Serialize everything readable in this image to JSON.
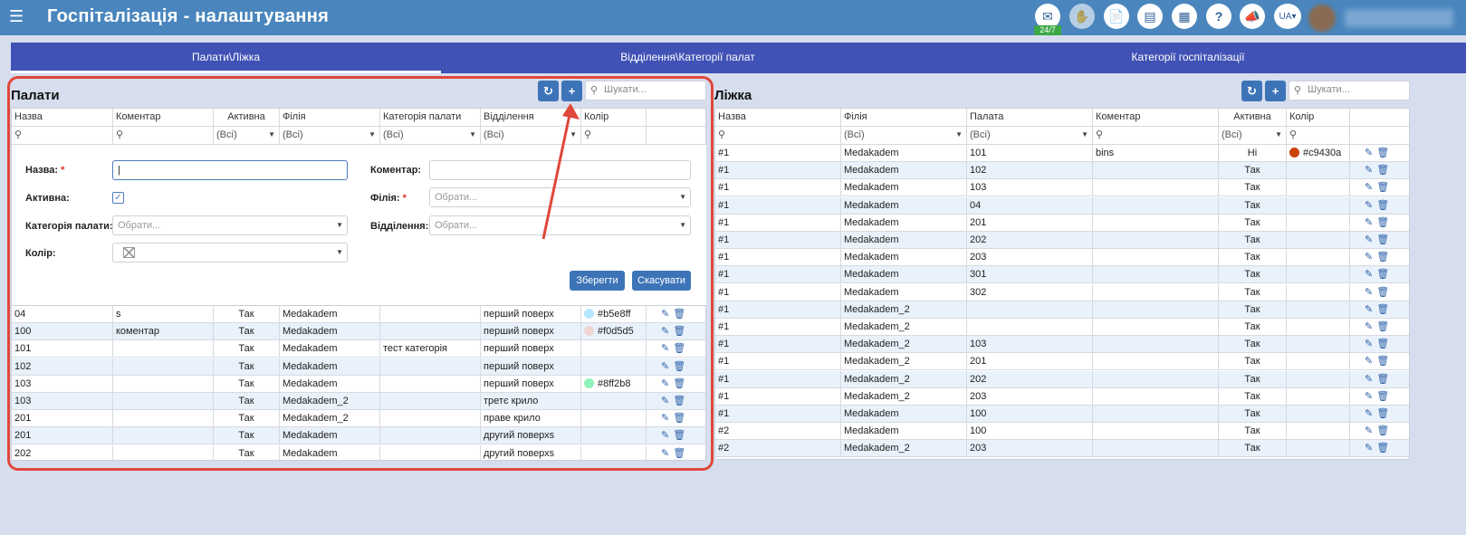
{
  "header": {
    "title": "Госпіталізація - налаштування",
    "menu_icon": "hamburger-icon",
    "chat_badge": "24/7",
    "lang": "UA"
  },
  "tabs": [
    {
      "label": "Палати\\Ліжка"
    },
    {
      "label": "Відділення\\Категорії палат"
    },
    {
      "label": "Категорії госпіталізації"
    }
  ],
  "wards": {
    "title": "Палати",
    "search_placeholder": "Шукати...",
    "columns": [
      "Назва",
      "Коментар",
      "Активна",
      "Філія",
      "Категорія палати",
      "Відділення",
      "Колір"
    ],
    "filter_all": "(Всі)",
    "form": {
      "name_label": "Назва:",
      "comment_label": "Коментар:",
      "active_label": "Активна:",
      "branch_label": "Філія:",
      "category_label": "Категорія палати:",
      "department_label": "Відділення:",
      "color_label": "Колір:",
      "select_placeholder": "Обрати...",
      "save_label": "Зберегти",
      "cancel_label": "Скасувати"
    },
    "rows": [
      {
        "name": "04",
        "comment": "s",
        "active": "Так",
        "branch": "Medakadem",
        "category": "",
        "department": "перший поверх",
        "color": "#b5e8ff"
      },
      {
        "name": "100",
        "comment": "коментар",
        "active": "Так",
        "branch": "Medakadem",
        "category": "",
        "department": "перший поверх",
        "color": "#f0d5d5"
      },
      {
        "name": "101",
        "comment": "",
        "active": "Так",
        "branch": "Medakadem",
        "category": "тест категорія",
        "department": "перший поверх",
        "color": ""
      },
      {
        "name": "102",
        "comment": "",
        "active": "Так",
        "branch": "Medakadem",
        "category": "",
        "department": "перший поверх",
        "color": ""
      },
      {
        "name": "103",
        "comment": "",
        "active": "Так",
        "branch": "Medakadem",
        "category": "",
        "department": "перший поверх",
        "color": "#8ff2b8"
      },
      {
        "name": "103",
        "comment": "",
        "active": "Так",
        "branch": "Medakadem_2",
        "category": "",
        "department": "третє крило",
        "color": ""
      },
      {
        "name": "201",
        "comment": "",
        "active": "Так",
        "branch": "Medakadem_2",
        "category": "",
        "department": "праве крило",
        "color": ""
      },
      {
        "name": "201",
        "comment": "",
        "active": "Так",
        "branch": "Medakadem",
        "category": "",
        "department": "другий поверхs",
        "color": ""
      },
      {
        "name": "202",
        "comment": "",
        "active": "Так",
        "branch": "Medakadem",
        "category": "",
        "department": "другий поверхs",
        "color": ""
      }
    ]
  },
  "beds": {
    "title": "Ліжка",
    "search_placeholder": "Шукати...",
    "columns": [
      "Назва",
      "Філія",
      "Палата",
      "Коментар",
      "Активна",
      "Колір"
    ],
    "filter_all": "(Всі)",
    "rows": [
      {
        "name": "#1",
        "branch": "Medakadem",
        "ward": "101",
        "comment": "bins",
        "active": "Ні",
        "color": "#c9430a"
      },
      {
        "name": "#1",
        "branch": "Medakadem",
        "ward": "102",
        "comment": "",
        "active": "Так",
        "color": ""
      },
      {
        "name": "#1",
        "branch": "Medakadem",
        "ward": "103",
        "comment": "",
        "active": "Так",
        "color": ""
      },
      {
        "name": "#1",
        "branch": "Medakadem",
        "ward": "04",
        "comment": "",
        "active": "Так",
        "color": ""
      },
      {
        "name": "#1",
        "branch": "Medakadem",
        "ward": "201",
        "comment": "",
        "active": "Так",
        "color": ""
      },
      {
        "name": "#1",
        "branch": "Medakadem",
        "ward": "202",
        "comment": "",
        "active": "Так",
        "color": ""
      },
      {
        "name": "#1",
        "branch": "Medakadem",
        "ward": "203",
        "comment": "",
        "active": "Так",
        "color": ""
      },
      {
        "name": "#1",
        "branch": "Medakadem",
        "ward": "301",
        "comment": "",
        "active": "Так",
        "color": ""
      },
      {
        "name": "#1",
        "branch": "Medakadem",
        "ward": "302",
        "comment": "",
        "active": "Так",
        "color": ""
      },
      {
        "name": "#1",
        "branch": "Medakadem_2",
        "ward": "",
        "comment": "",
        "active": "Так",
        "color": ""
      },
      {
        "name": "#1",
        "branch": "Medakadem_2",
        "ward": "",
        "comment": "",
        "active": "Так",
        "color": ""
      },
      {
        "name": "#1",
        "branch": "Medakadem_2",
        "ward": "103",
        "comment": "",
        "active": "Так",
        "color": ""
      },
      {
        "name": "#1",
        "branch": "Medakadem_2",
        "ward": "201",
        "comment": "",
        "active": "Так",
        "color": ""
      },
      {
        "name": "#1",
        "branch": "Medakadem_2",
        "ward": "202",
        "comment": "",
        "active": "Так",
        "color": ""
      },
      {
        "name": "#1",
        "branch": "Medakadem_2",
        "ward": "203",
        "comment": "",
        "active": "Так",
        "color": ""
      },
      {
        "name": "#1",
        "branch": "Medakadem",
        "ward": "100",
        "comment": "",
        "active": "Так",
        "color": ""
      },
      {
        "name": "#2",
        "branch": "Medakadem",
        "ward": "100",
        "comment": "",
        "active": "Так",
        "color": ""
      },
      {
        "name": "#2",
        "branch": "Medakadem_2",
        "ward": "203",
        "comment": "",
        "active": "Так",
        "color": ""
      }
    ]
  }
}
